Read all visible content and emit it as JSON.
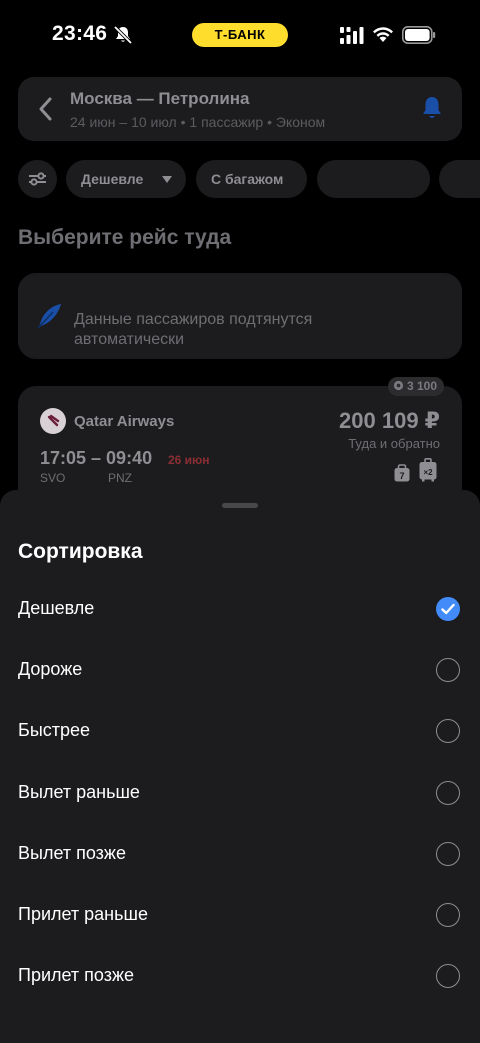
{
  "status_bar": {
    "time": "23:46",
    "bank_label": "Т-БАНК",
    "icons": [
      "bell-slash-icon",
      "signal-icon",
      "wifi-icon",
      "battery-icon"
    ]
  },
  "search": {
    "route": "Москва — Петролина",
    "details": "24 июн – 10 июл • 1 пассажир • Эконом"
  },
  "filters": {
    "sort_label": "Дешевле",
    "baggage_label": "С багажом"
  },
  "section_title": "Выберите рейс туда",
  "info_card": {
    "line1": "Данные пассажиров подтянутся",
    "line2": "автоматически"
  },
  "flight": {
    "cashback": "3 100",
    "airline": "Qatar Airways",
    "price": "200 109 ₽",
    "price_note": "Туда и обратно",
    "times": "17:05 – 09:40",
    "arrival_date": "26 июн",
    "from_code": "SVO",
    "to_code": "PNZ",
    "bag_count": "7",
    "suitcase_count": "×2"
  },
  "sort_sheet": {
    "title": "Сортировка",
    "options": [
      {
        "label": "Дешевле",
        "selected": true
      },
      {
        "label": "Дороже",
        "selected": false
      },
      {
        "label": "Быстрее",
        "selected": false
      },
      {
        "label": "Вылет раньше",
        "selected": false
      },
      {
        "label": "Вылет позже",
        "selected": false
      },
      {
        "label": "Прилет раньше",
        "selected": false
      },
      {
        "label": "Прилет позже",
        "selected": false
      }
    ]
  },
  "colors": {
    "accent_blue": "#428bf9",
    "brand_yellow": "#ffdd2d",
    "sheet_bg": "#1c1c1e",
    "alert_red": "#8b2e33"
  }
}
